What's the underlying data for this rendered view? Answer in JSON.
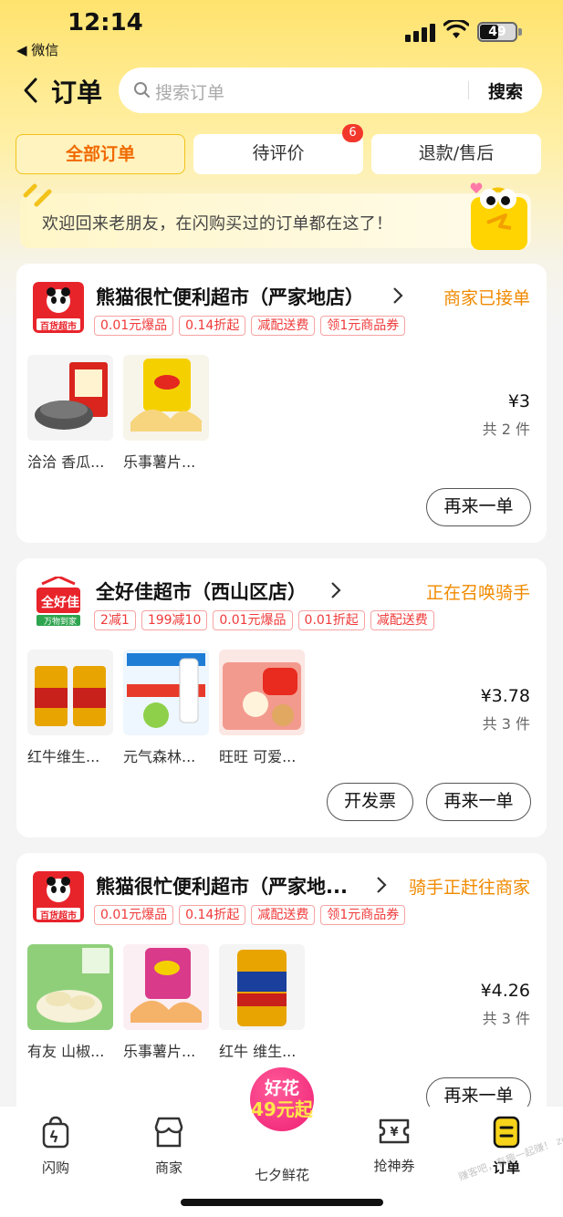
{
  "status_bar": {
    "time": "12:14",
    "back_app": "◀ 微信",
    "battery": "49"
  },
  "header": {
    "title": "订单",
    "search_placeholder": "搜索订单",
    "search_button": "搜索"
  },
  "tabs": [
    {
      "label": "全部订单",
      "active": true
    },
    {
      "label": "待评价",
      "badge": "6"
    },
    {
      "label": "退款/售后"
    }
  ],
  "banner": {
    "text": "欢迎回来老朋友，在闪购买过的订单都在这了！"
  },
  "orders": [
    {
      "store": "熊猫很忙便利超市（严家地店）",
      "logo_top": "熊猫很忙",
      "logo_bottom": "百货超市",
      "status": "商家已接单",
      "tags": [
        "0.01元爆品",
        "0.14折起",
        "减配送费",
        "领1元商品券"
      ],
      "items": [
        "洽洽 香瓜...",
        "乐事薯片..."
      ],
      "price": "¥3",
      "count": "共 2 件",
      "buttons": [
        "再来一单"
      ]
    },
    {
      "store": "全好佳超市（西山区店）",
      "logo_top": "全好佳",
      "logo_bottom": "万物到家",
      "status": "正在召唤骑手",
      "tags": [
        "2减1",
        "199减10",
        "0.01元爆品",
        "0.01折起",
        "减配送费"
      ],
      "items": [
        "红牛维生...",
        "元气森林...",
        "旺旺 可爱..."
      ],
      "price": "¥3.78",
      "count": "共 3 件",
      "buttons": [
        "开发票",
        "再来一单"
      ]
    },
    {
      "store": "熊猫很忙便利超市（严家地...",
      "logo_top": "熊猫很忙",
      "logo_bottom": "百货超市",
      "status": "骑手正赶往商家",
      "tags": [
        "0.01元爆品",
        "0.14折起",
        "减配送费",
        "领1元商品券"
      ],
      "items": [
        "有友 山椒...",
        "乐事薯片...",
        "红牛 维生..."
      ],
      "price": "¥4.26",
      "count": "共 3 件",
      "buttons": [
        "再来一单"
      ]
    }
  ],
  "bottom_nav": [
    {
      "label": "闪购",
      "icon": "shopping-bag-icon"
    },
    {
      "label": "商家",
      "icon": "store-icon"
    },
    {
      "label": "七夕鲜花",
      "icon": "promo-flower"
    },
    {
      "label": "抢神券",
      "icon": "coupon-icon"
    },
    {
      "label": "订单",
      "icon": "order-icon",
      "active": true
    }
  ],
  "promo": {
    "line1": "好花",
    "line2": "49元起"
  },
  "watermark": "赚客吧，有趣一起赚！ zuanke8",
  "colors": {
    "accent": "#f06a00",
    "status": "#f08a00",
    "tag": "#f03a3a",
    "header_bg": "#ffe36e"
  }
}
